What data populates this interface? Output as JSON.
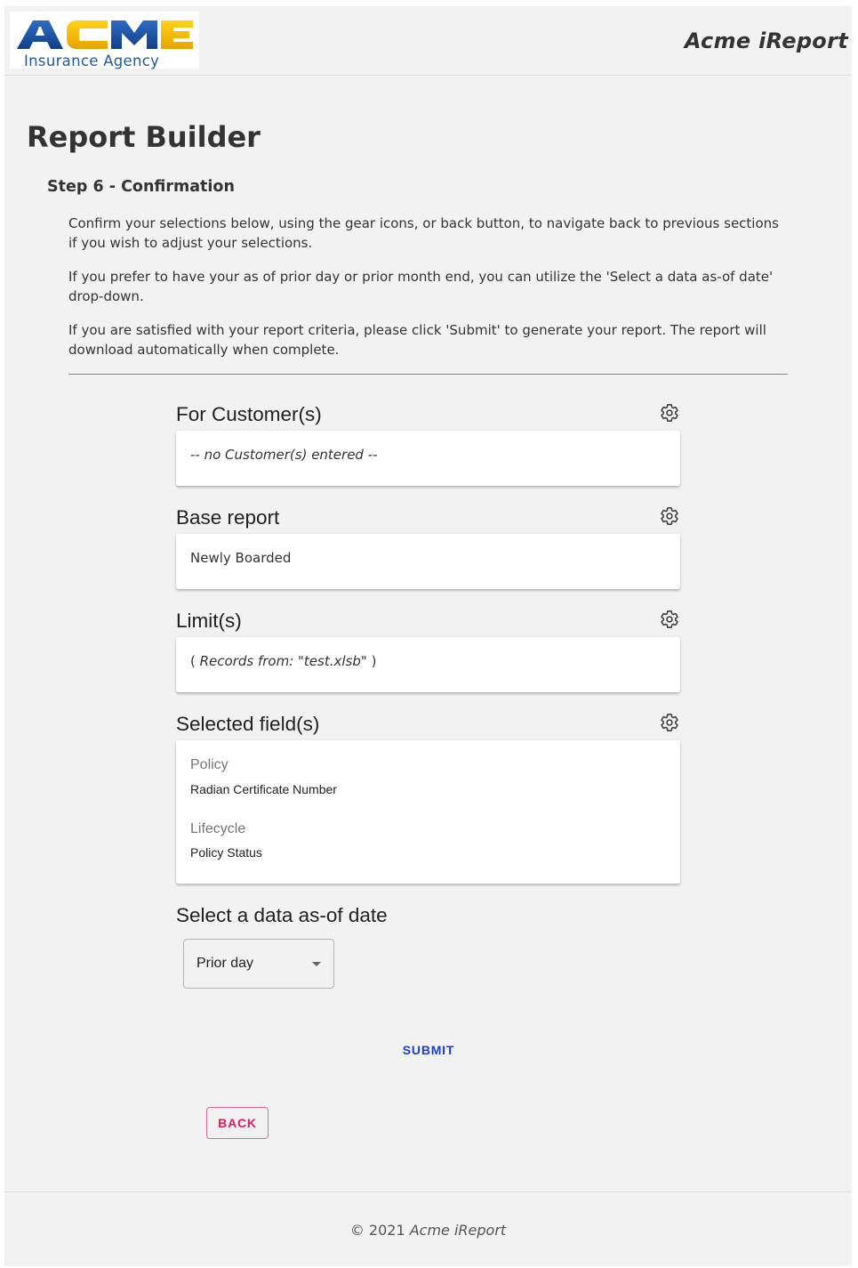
{
  "header": {
    "logo": {
      "word": "ACME",
      "subtitle": "Insurance Agency"
    },
    "app_title": "Acme iReport"
  },
  "page": {
    "title": "Report Builder",
    "step_title": "Step 6 - Confirmation",
    "paragraphs": [
      "Confirm your selections below, using the gear icons, or back button, to navigate back to previous sections if you wish to adjust your selections.",
      "If you prefer to have your as of prior day or prior month end, you can utilize the 'Select a data as-of date' drop-down.",
      "If you are satisfied with your report criteria, please click 'Submit' to generate your report. The report will download automatically when complete."
    ]
  },
  "sections": {
    "customers": {
      "title": "For Customer(s)",
      "value": "-- no Customer(s) entered --"
    },
    "base_report": {
      "title": "Base report",
      "value": "Newly Boarded"
    },
    "limits": {
      "title": "Limit(s)",
      "open": "( ",
      "label": "Records from: ",
      "file": "\"test.xlsb\"",
      "close": " )"
    },
    "fields": {
      "title": "Selected field(s)",
      "groups": [
        {
          "label": "Policy",
          "item": "Radian Certificate Number"
        },
        {
          "label": "Lifecycle",
          "item": "Policy Status"
        }
      ]
    }
  },
  "asof": {
    "title": "Select a data as-of date",
    "selected": "Prior day"
  },
  "buttons": {
    "submit": "SUBMIT",
    "back": "BACK"
  },
  "footer": {
    "copyright": "© 2021",
    "app": "Acme iReport"
  },
  "colors": {
    "background": "#f2f2f2",
    "logo_blue": "#1f4fa0",
    "logo_yellow": "#f5b800",
    "submit_text": "#1e3ccf",
    "back_text": "#dc1f55"
  },
  "icons": {
    "section_action": "gear-icon",
    "select_caret": "caret-down-icon"
  }
}
